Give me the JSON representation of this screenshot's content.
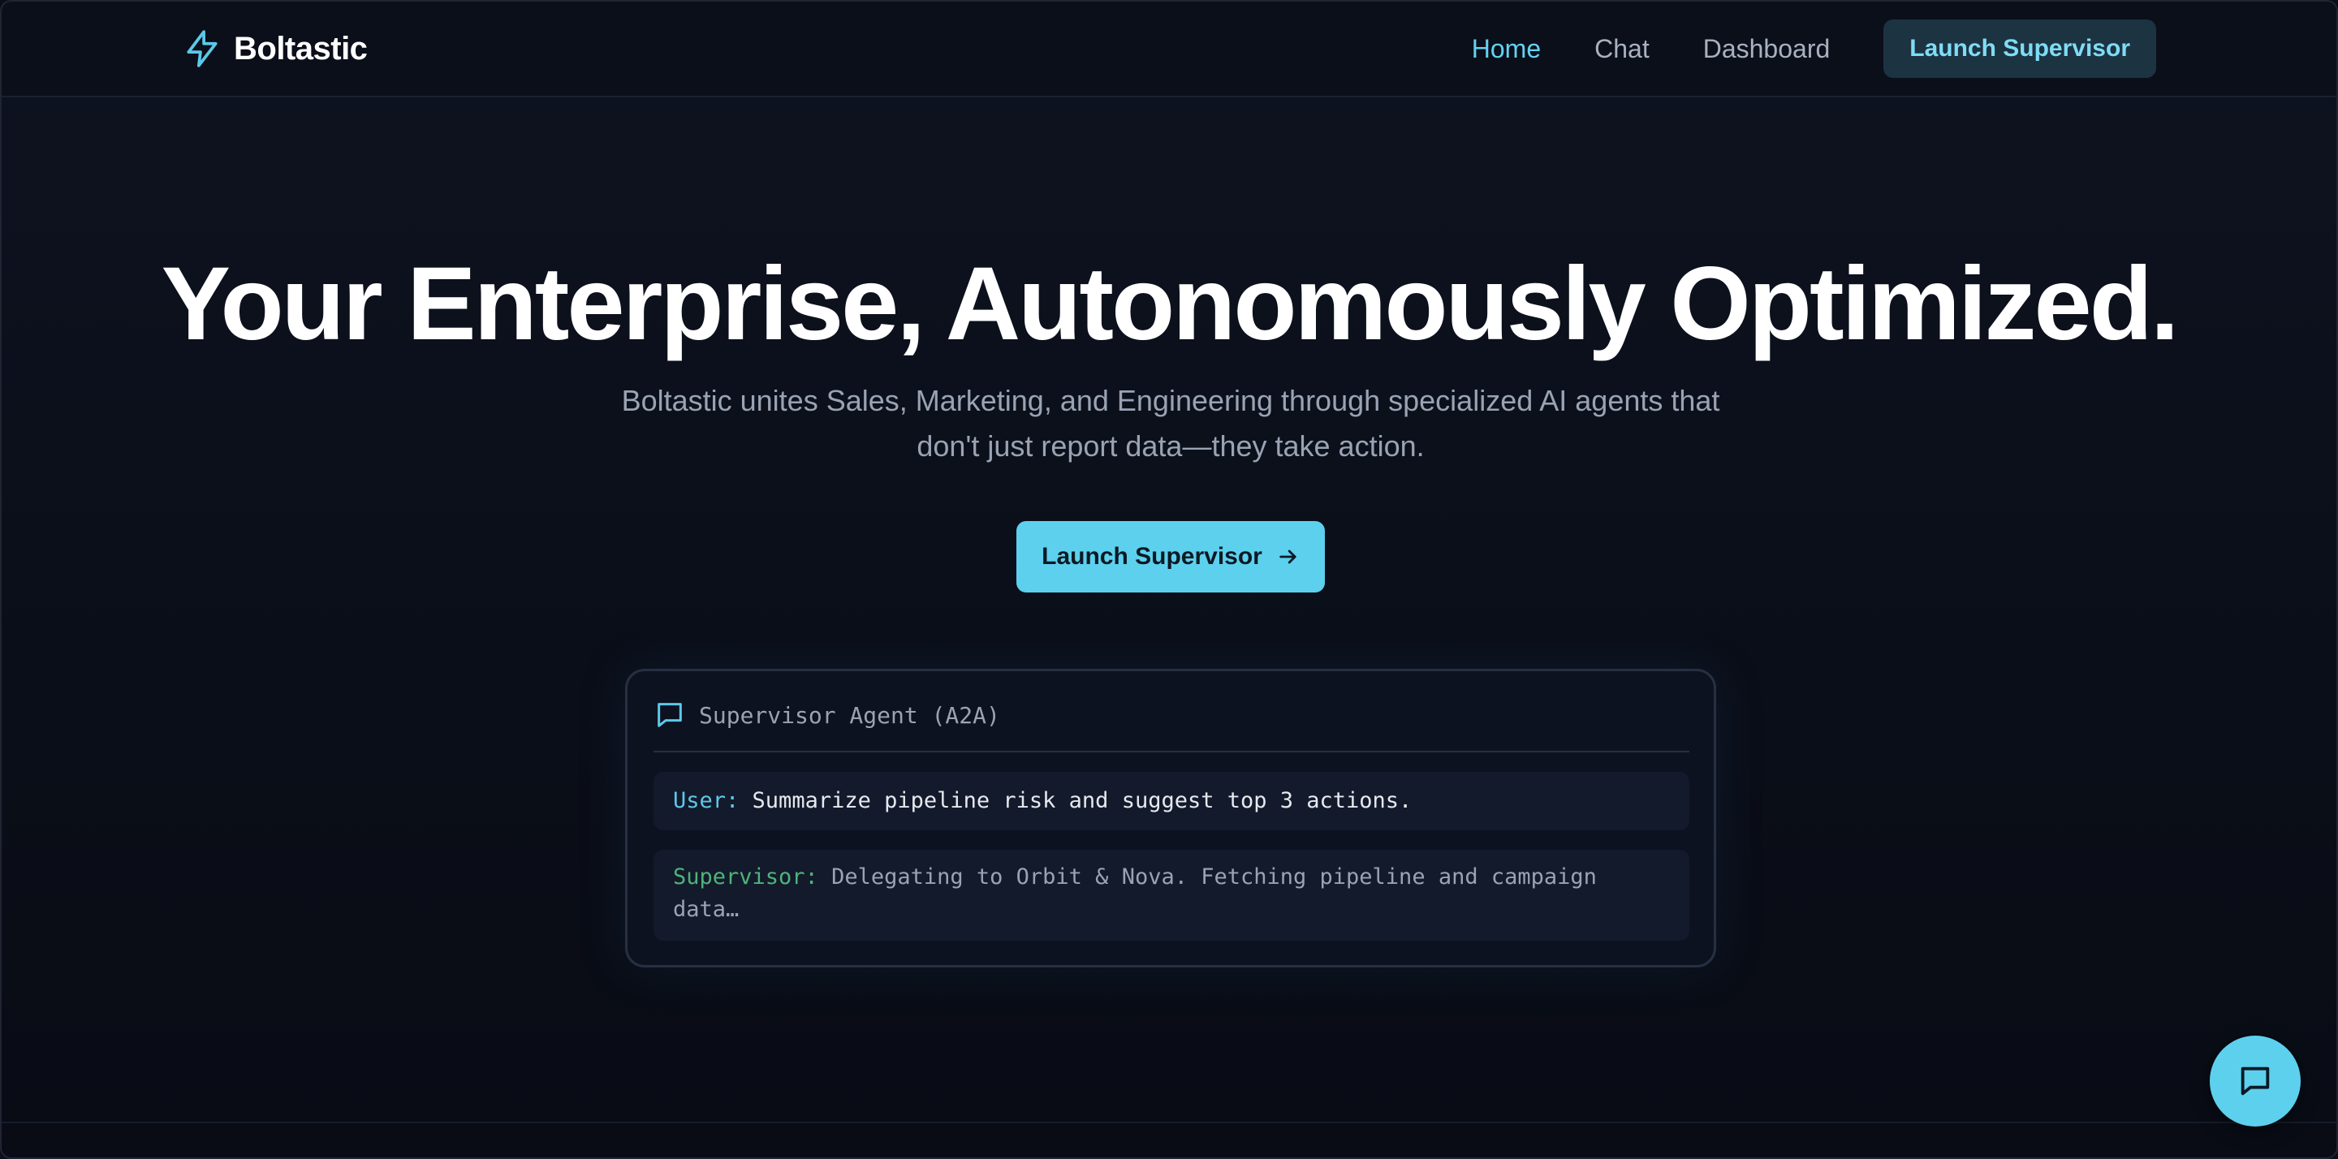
{
  "brand": {
    "name": "Boltastic",
    "icon": "bolt-icon"
  },
  "nav": {
    "links": [
      {
        "label": "Home",
        "active": true
      },
      {
        "label": "Chat",
        "active": false
      },
      {
        "label": "Dashboard",
        "active": false
      }
    ],
    "cta_label": "Launch Supervisor"
  },
  "hero": {
    "title": "Your Enterprise, Autonomously Optimized.",
    "subtitle": "Boltastic unites Sales, Marketing, and Engineering through specialized AI agents that don't just report data—they take action.",
    "cta_label": "Launch Supervisor",
    "cta_icon": "arrow-right-icon"
  },
  "chat_preview": {
    "title": "Supervisor Agent (A2A)",
    "icon": "chat-bubble-icon",
    "messages": [
      {
        "role": "User:",
        "text": "Summarize pipeline risk and suggest top 3 actions."
      },
      {
        "role": "Supervisor:",
        "text": "Delegating to Orbit & Nova. Fetching pipeline and campaign data…"
      }
    ]
  },
  "fab": {
    "icon": "chat-bubble-icon"
  },
  "colors": {
    "accent": "#5dd0ee",
    "accent_text": "#63d2f0",
    "supervisor": "#4fb37a",
    "background": "#0a0e18"
  }
}
